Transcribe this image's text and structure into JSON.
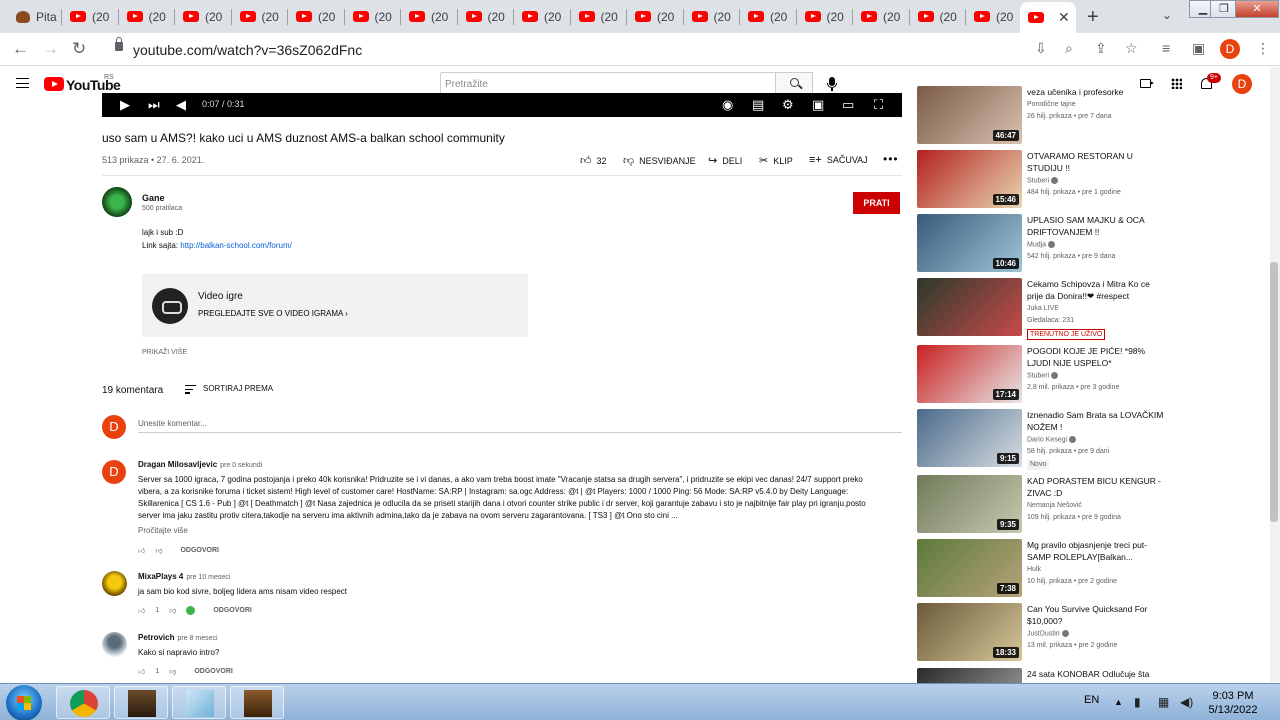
{
  "browser": {
    "first_tab_title": "Pita",
    "tab_label": "(20",
    "tab_count_youtube": 17,
    "url": "youtube.com/watch?v=36sZ062dFnc",
    "profile_initial": "D"
  },
  "yt_header": {
    "logo_text": "YouTube",
    "region": "RS",
    "search_placeholder": "Pretražite",
    "notifications_badge": "9+",
    "avatar_initial": "D"
  },
  "player": {
    "time": "0:07 / 0:31"
  },
  "video": {
    "title": "uso sam u AMS?! kako uci u AMS duznost AMS-a balkan school community",
    "meta": "513 prikaza • 27. 6. 2021.",
    "like_count": "32",
    "dislike_label": "NESVIĐANJE",
    "share_label": "DELI",
    "clip_label": "KLIP",
    "save_label": "SAČUVAJ"
  },
  "channel": {
    "name": "Gane",
    "subscribers": "500 pratilaca",
    "subscribe_label": "PRATI",
    "description_line1": "lajk i sub :D",
    "description_link_prefix": "Link sajta: ",
    "description_link": "http://balkan-school.com/forum/"
  },
  "game_card": {
    "title": "Video igre",
    "link": "PREGLEDAJTE SVE O VIDEO IGRAMA"
  },
  "show_more": "PRIKAŽI VIŠE",
  "comments": {
    "count_label": "19 komentara",
    "sort_label": "SORTIRAJ PREMA",
    "add_placeholder": "Unesite komentar...",
    "my_initial": "D",
    "reply_label": "ODGOVORI",
    "items": [
      {
        "author": "Dragan Milosavljevic",
        "time": "pre 0 sekundi",
        "avatar_initial": "D",
        "text": "Server sa 1000 igraca, 7 godina postojanja i preko 40k korisnika! Pridruzite se i vi danas, a ako vam treba boost imate \"Vracanje statsa sa drugih servera\", i pridruzite se ekipi vec danas! 24/7 support preko vibera, a za korisnike foruma i ticket sistem! High level of customer care! HostName: SA:RP | Instagram: sa.ogc Address: @t | @t Players: 1000 / 1000 Ping: 56 Mode: SA:RP v5.4.0 by Deity Language: Skillarenica [ CS 1.6 - Pub ] @t [ Deathmatch ] @t Nasa zajednica je odlucila da se priseti starijih dana i otvori counter strike public i dr server, koji garantuje zabavu i sto je najbitnije fair play pri igranju,posto server ima jaku zastitu protiv citera,takodje na serveru ima aktivnih admina,tako da je zabava na ovom serveru zagarantovana. [ TS3 ] @t Ono sto cini ...",
        "read_more": "Pročitajte više",
        "likes": ""
      },
      {
        "author": "MixaPlays 4",
        "time": "pre 10 meseci",
        "text": "ja sam bio kod sivre, boljeg lidera ams nisam video respect",
        "likes": "1"
      },
      {
        "author": "Petrovich",
        "time": "pre 8 meseci",
        "text": "Kako si napravio intro?",
        "likes": "1"
      }
    ]
  },
  "recommendations": [
    {
      "title": "veza učenika i profesorke",
      "channel": "Porodične tajne",
      "meta": "26 hilj. prikaza • pre 7 dana",
      "duration": "46:47",
      "verified": false
    },
    {
      "title": "OTVARAMO RESTORAN U STUDIJU !!",
      "channel": "Stuberi",
      "meta": "484 hilj. prikaza • pre 1 godine",
      "duration": "15:46",
      "verified": true
    },
    {
      "title": "UPLASIO SAM MAJKU & OCA DRIFTOVANJEM !!",
      "channel": "Mudja",
      "meta": "542 hilj. prikaza • pre 9 dana",
      "duration": "10:46",
      "verified": true
    },
    {
      "title": "Cekamo Schipovza i Mitra Ko ce prije da Donira!!❤ #respect",
      "channel": "Juka LIVE",
      "meta": "Gledalaca: 231",
      "live_badge": "TRENUTNO JE UŽIVO",
      "duration": "",
      "verified": false
    },
    {
      "title": "POGODI KOJE JE PIĆE! *98% LJUDI NIJE USPELO*",
      "channel": "Stuberi",
      "meta": "2,8 mil. prikaza • pre 3 godine",
      "duration": "17:14",
      "verified": true
    },
    {
      "title": "Iznenadio Sam Brata sa LOVAČKIM NOŽEM !",
      "channel": "Dario Kesegi",
      "meta": "58 hilj. prikaza • pre 9 dani",
      "new_badge": "Novo",
      "duration": "9:15",
      "verified": true
    },
    {
      "title": "KAD PORASTEM BICU KENGUR - ZIVAC :D",
      "channel": "Nemanja Nešović",
      "meta": "109 hilj. prikaza • pre 9 godina",
      "duration": "9:35",
      "verified": false
    },
    {
      "title": "Mg pravilo objasnjenje treci put-SAMP ROLEPLAY[Balkan...",
      "channel": "Hulk",
      "meta": "10 hilj. prikaza • pre 2 godine",
      "duration": "7:38",
      "verified": false
    },
    {
      "title": "Can You Survive Quicksand For $10,000?",
      "channel": "JustDustin",
      "meta": "13 mil. prikaza • pre 2 godine",
      "duration": "18:33",
      "verified": true
    },
    {
      "title": "24 sata KONOBAR Odlučuje šta",
      "channel": "",
      "meta": "",
      "duration": "",
      "verified": false
    }
  ],
  "taskbar": {
    "lang": "EN",
    "time": "9:03 PM",
    "date": "5/13/2022"
  }
}
